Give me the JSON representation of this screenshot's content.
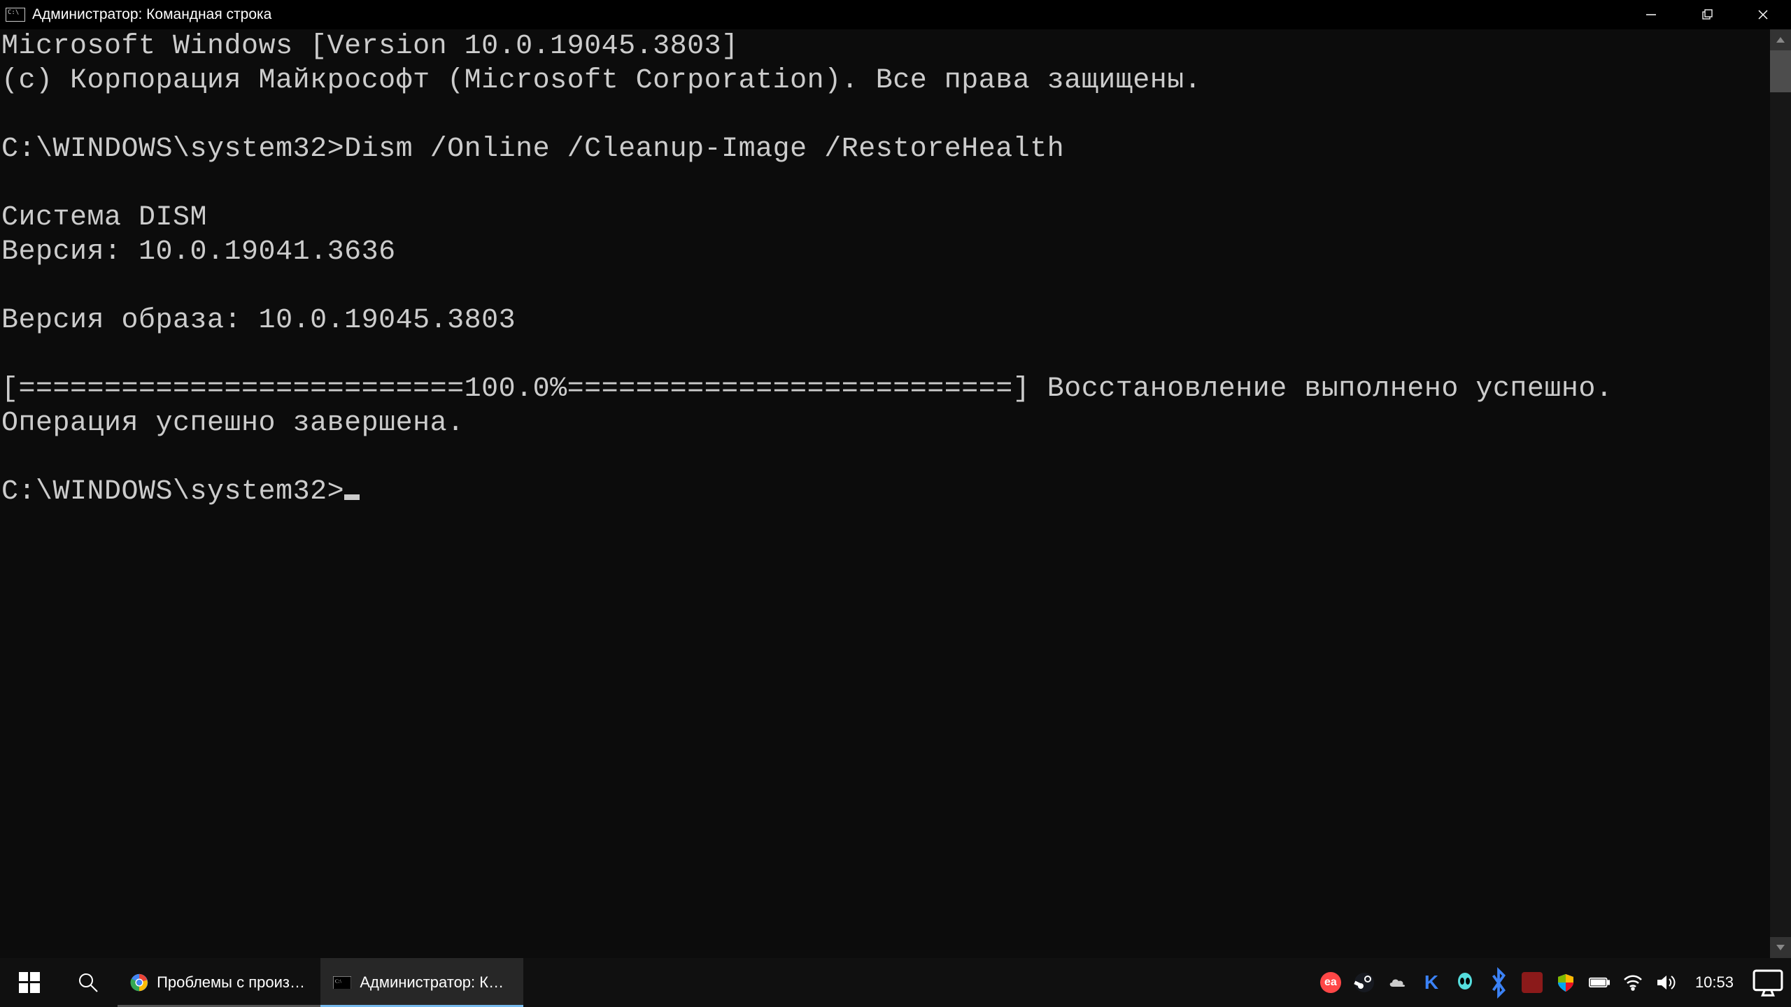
{
  "titlebar": {
    "title": "Администратор: Командная строка"
  },
  "console": {
    "line1": "Microsoft Windows [Version 10.0.19045.3803]",
    "line2": "(c) Корпорация Майкрософт (Microsoft Corporation). Все права защищены.",
    "blank1": "",
    "prompt1": "C:\\WINDOWS\\system32>Dism /Online /Cleanup-Image /RestoreHealth",
    "blank2": "",
    "dism_header": "Cистема DISM",
    "dism_version": "Версия: 10.0.19041.3636",
    "blank3": "",
    "image_version": "Версия образа: 10.0.19045.3803",
    "blank4": "",
    "progress": "[==========================100.0%==========================] Восстановление выполнено успешно.",
    "success": "Операция успешно завершена.",
    "blank5": "",
    "prompt2": "C:\\WINDOWS\\system32>"
  },
  "taskbar": {
    "chrome_task": "Проблемы с произво...",
    "cmd_task": "Администратор: Ком...",
    "clock": "10:53"
  }
}
